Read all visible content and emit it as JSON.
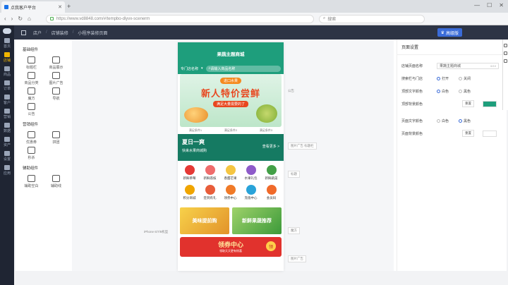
{
  "browser": {
    "tab_title": "点我客户平台",
    "url": "https://www.vd8848.com/#/tempbo-diyvx-scenerm",
    "search_label": "搜索"
  },
  "sidebar": {
    "items": [
      {
        "label": "首页",
        "active": false
      },
      {
        "label": "店铺",
        "active": true
      },
      {
        "label": "商品",
        "active": false
      },
      {
        "label": "订单",
        "active": false
      },
      {
        "label": "客户",
        "active": false
      },
      {
        "label": "营销",
        "active": false
      },
      {
        "label": "数据",
        "active": false
      },
      {
        "label": "资产",
        "active": false
      },
      {
        "label": "设置",
        "active": false
      },
      {
        "label": "应用",
        "active": false
      }
    ]
  },
  "topnav": {
    "crumb1": "店户",
    "crumb2": "店铺装修",
    "crumb3": "小程序装修页面",
    "vip_label": "高级版"
  },
  "components": {
    "basic_title": "基础组件",
    "basic": [
      "标题栏",
      "商品展示",
      "商品分类",
      "图片广告",
      "魔方",
      "导航",
      "公告"
    ],
    "marketing_title": "营销组件",
    "marketing": [
      "优惠券",
      "拼团",
      "秒杀"
    ],
    "assist_title": "辅助组件",
    "assist": [
      "辅助空白",
      "辅助线"
    ]
  },
  "phone": {
    "header_title": "果蔬主题商城",
    "store_label": "专门店名称",
    "search_placeholder": "请输入商品名称",
    "banner_pill": "进口水果",
    "banner_big": "新人特价尝鲜",
    "banner_sub": "满足大量需要的了",
    "note1": "满足条件1",
    "note2": "满足条件2",
    "note3": "满足条件3",
    "promo_title": "夏日一爽",
    "promo_sub": "快来水果商城购",
    "promo_more": "查看更多 >",
    "categories": [
      {
        "label": "新鲜草莓",
        "color": "#e53935"
      },
      {
        "label": "新鲜荔枝",
        "color": "#ef6c6c"
      },
      {
        "label": "香甜芒果",
        "color": "#f5c542"
      },
      {
        "label": "水果礼包",
        "color": "#8e5bc9"
      },
      {
        "label": "新鲜蔬菜",
        "color": "#43a047"
      },
      {
        "label": "积分商城",
        "color": "#f0a500"
      },
      {
        "label": "签到有礼",
        "color": "#e85d3a"
      },
      {
        "label": "领券中心",
        "color": "#f07a28"
      },
      {
        "label": "充值中心",
        "color": "#29a3d9"
      },
      {
        "label": "会员码",
        "color": "#f06a2a"
      }
    ],
    "dual_left": "美味提前购",
    "dual_right": "新鲜果蔬推荐",
    "coupon_title": "领券中心",
    "coupon_sub": "领取天天更有惊喜",
    "coupon_get": "领"
  },
  "canvas_labels": {
    "device": "iPhone 6/7/8机型",
    "tag_notice": "公告",
    "tag_ad": "图片广告\n标题栏",
    "tag_title": "标题",
    "tag_cube": "魔方",
    "tag_ad2": "图片广告"
  },
  "settings": {
    "title": "页面设置",
    "name_label": "店铺页面名称",
    "name_value": "果蔬主题商城",
    "name_count": "6/10",
    "store_show_label": "搜索栏与门店",
    "opt_open": "打开",
    "opt_close": "关闭",
    "top_text_color_label": "顶部文字颜色",
    "opt_white": "白色",
    "opt_black": "黑色",
    "top_bg_label": "顶部背景颜色",
    "reset": "重置",
    "top_bg_color": "#1e9e7c",
    "page_text_color_label": "页面文字颜色",
    "page_bg_label": "页面背景颜色",
    "page_bg_color": "#ffffff"
  }
}
